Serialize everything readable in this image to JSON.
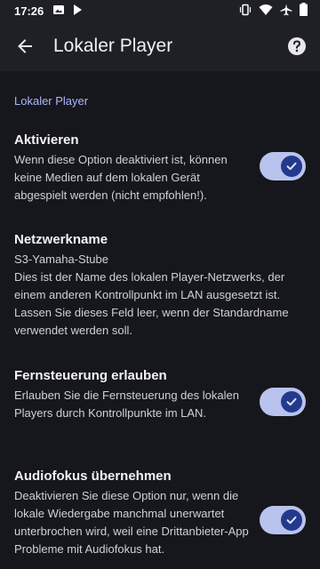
{
  "status_bar": {
    "time": "17:26",
    "icons_left": [
      "image-icon",
      "play-icon"
    ],
    "icons_right": [
      "vibrate-icon",
      "wifi-icon",
      "airplane-icon",
      "battery-icon"
    ]
  },
  "app_bar": {
    "title": "Lokaler Player",
    "back_icon": "arrow-left-icon",
    "help_icon": "help-circle-icon"
  },
  "section": {
    "header": "Lokaler Player"
  },
  "prefs": [
    {
      "title": "Aktivieren",
      "description": "Wenn diese Option deaktiviert ist, können keine Medien auf dem lokalen Gerät abgespielt werden (nicht empfohlen!).",
      "switch_on": true
    },
    {
      "title": "Netzwerkname",
      "value": "S3-Yamaha-Stube",
      "description": "Dies ist der Name des lokalen Player-Netzwerks, der einem anderen Kontrollpunkt im LAN ausgesetzt ist. Lassen Sie dieses Feld leer, wenn der Standardname verwendet werden soll."
    },
    {
      "title": "Fernsteuerung erlauben",
      "description": "Erlauben Sie die Fernsteuerung des lokalen Players durch Kontrollpunkte im LAN.",
      "switch_on": true
    },
    {
      "title": "Audiofokus übernehmen",
      "description": "Deaktivieren Sie diese Option nur, wenn die lokale Wiedergabe manchmal unerwartet unterbrochen wird, weil eine Drittanbieter-App Probleme mit Audiofokus hat.",
      "switch_on": true
    }
  ],
  "colors": {
    "background": "#16171c",
    "appbar": "#1f2026",
    "accent": "#a9b8ff",
    "switch_track": "#b9c3ee",
    "switch_thumb": "#233a8c"
  }
}
